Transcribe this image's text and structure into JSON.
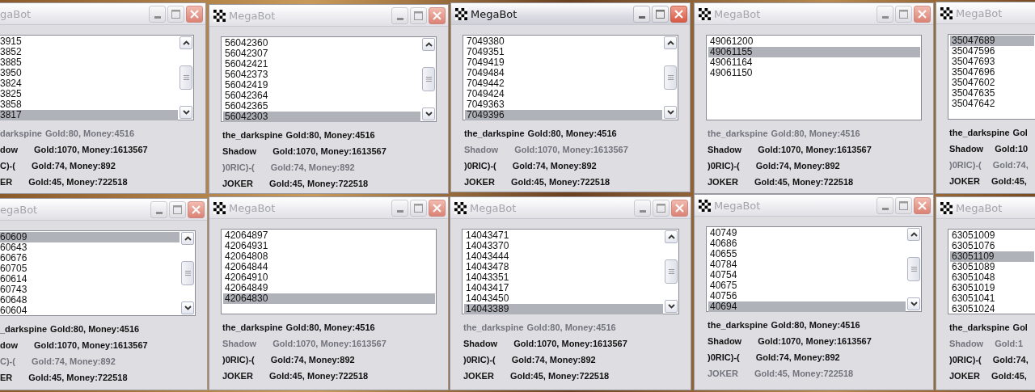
{
  "windows": [
    {
      "kind": "left-cut",
      "title": "gaBot",
      "active": false,
      "scrollbar": true,
      "items": [
        {
          "text": "3915",
          "selected": false
        },
        {
          "text": "3852",
          "selected": false
        },
        {
          "text": "3885",
          "selected": false
        },
        {
          "text": "3950",
          "selected": false
        },
        {
          "text": "3824",
          "selected": false
        },
        {
          "text": "3825",
          "selected": false
        },
        {
          "text": "3858",
          "selected": false
        },
        {
          "text": "3817",
          "selected": true
        }
      ],
      "players": [
        {
          "name": "darkspine",
          "stats": "Gold:80, Money:4516",
          "highlighted": true
        },
        {
          "name": "dow",
          "stats": "Gold:1070, Money:1613567",
          "highlighted": false
        },
        {
          "name": "C)-(",
          "stats": "Gold:74, Money:892",
          "highlighted": false
        },
        {
          "name": "ER",
          "stats": "Gold:45, Money:722518",
          "highlighted": false
        }
      ]
    },
    {
      "kind": "full",
      "title": "MegaBot",
      "active": false,
      "scrollbar": true,
      "items": [
        {
          "text": "56042360",
          "selected": false
        },
        {
          "text": "56042307",
          "selected": false
        },
        {
          "text": "56042421",
          "selected": false
        },
        {
          "text": "56042373",
          "selected": false
        },
        {
          "text": "56042419",
          "selected": false
        },
        {
          "text": "56042364",
          "selected": false
        },
        {
          "text": "56042365",
          "selected": false
        },
        {
          "text": "56042303",
          "selected": true
        }
      ],
      "players": [
        {
          "name": "the_darkspine",
          "stats": "Gold:80, Money:4516",
          "highlighted": false
        },
        {
          "name": "Shadow",
          "stats": "Gold:1070, Money:1613567",
          "highlighted": false
        },
        {
          "name": ")0RIC)-(",
          "stats": "Gold:74, Money:892",
          "highlighted": true
        },
        {
          "name": "JOKER",
          "stats": "Gold:45, Money:722518",
          "highlighted": false
        }
      ]
    },
    {
      "kind": "full",
      "title": "MegaBot",
      "active": true,
      "scrollbar": true,
      "items": [
        {
          "text": "7049380",
          "selected": false
        },
        {
          "text": "7049351",
          "selected": false
        },
        {
          "text": "7049419",
          "selected": false
        },
        {
          "text": "7049484",
          "selected": false
        },
        {
          "text": "7049442",
          "selected": false
        },
        {
          "text": "7049424",
          "selected": false
        },
        {
          "text": "7049363",
          "selected": false
        },
        {
          "text": "7049396",
          "selected": true
        }
      ],
      "players": [
        {
          "name": "the_darkspine",
          "stats": "Gold:80, Money:4516",
          "highlighted": false
        },
        {
          "name": "Shadow",
          "stats": "Gold:1070, Money:1613567",
          "highlighted": true
        },
        {
          "name": ")0RIC)-(",
          "stats": "Gold:74, Money:892",
          "highlighted": false
        },
        {
          "name": "JOKER",
          "stats": "Gold:45, Money:722518",
          "highlighted": false
        }
      ]
    },
    {
      "kind": "full",
      "title": "MegaBot",
      "active": false,
      "scrollbar": false,
      "items": [
        {
          "text": "49061200",
          "selected": false
        },
        {
          "text": "49061155",
          "selected": true
        },
        {
          "text": "49061164",
          "selected": false
        },
        {
          "text": "49061150",
          "selected": false
        }
      ],
      "players": [
        {
          "name": "the_darkspine",
          "stats": "Gold:80, Money:4516",
          "highlighted": true
        },
        {
          "name": "Shadow",
          "stats": "Gold:1070, Money:1613567",
          "highlighted": false
        },
        {
          "name": ")0RIC)-(",
          "stats": "Gold:74, Money:892",
          "highlighted": false
        },
        {
          "name": "JOKER",
          "stats": "Gold:45, Money:722518",
          "highlighted": false
        }
      ]
    },
    {
      "kind": "right-cut",
      "title": "MegaBot",
      "active": false,
      "scrollbar": false,
      "items": [
        {
          "text": "35047689",
          "selected": true
        },
        {
          "text": "35047596",
          "selected": false
        },
        {
          "text": "35047693",
          "selected": false
        },
        {
          "text": "35047696",
          "selected": false
        },
        {
          "text": "35047602",
          "selected": false
        },
        {
          "text": "35047635",
          "selected": false
        },
        {
          "text": "35047642",
          "selected": false
        }
      ],
      "players": [
        {
          "name": "the_darkspine",
          "stats": "Gol",
          "highlighted": false
        },
        {
          "name": "Shadow",
          "stats": "Gold:10",
          "highlighted": false
        },
        {
          "name": ")0RIC)-(",
          "stats": "Gold:74,",
          "highlighted": true
        },
        {
          "name": "JOKER",
          "stats": "Gold:45,",
          "highlighted": false
        }
      ]
    },
    {
      "kind": "left-cut",
      "title": "egaBot",
      "active": false,
      "scrollbar": true,
      "items": [
        {
          "text": "60609",
          "selected": true
        },
        {
          "text": "60643",
          "selected": false
        },
        {
          "text": "60676",
          "selected": false
        },
        {
          "text": "60705",
          "selected": false
        },
        {
          "text": "60614",
          "selected": false
        },
        {
          "text": "60743",
          "selected": false
        },
        {
          "text": "60648",
          "selected": false
        },
        {
          "text": "60604",
          "selected": false
        }
      ],
      "players": [
        {
          "name": "_darkspine",
          "stats": "Gold:80, Money:4516",
          "highlighted": false
        },
        {
          "name": "dow",
          "stats": "Gold:1070, Money:1613567",
          "highlighted": false
        },
        {
          "name": "C)-(",
          "stats": "Gold:74, Money:892",
          "highlighted": true
        },
        {
          "name": "ER",
          "stats": "Gold:45, Money:722518",
          "highlighted": false
        }
      ]
    },
    {
      "kind": "full",
      "title": "MegaBot",
      "active": false,
      "scrollbar": false,
      "items": [
        {
          "text": "42064897",
          "selected": false
        },
        {
          "text": "42064931",
          "selected": false
        },
        {
          "text": "42064808",
          "selected": false
        },
        {
          "text": "42064844",
          "selected": false
        },
        {
          "text": "42064910",
          "selected": false
        },
        {
          "text": "42064849",
          "selected": false
        },
        {
          "text": "42064830",
          "selected": true
        }
      ],
      "players": [
        {
          "name": "the_darkspine",
          "stats": "Gold:80, Money:4516",
          "highlighted": false
        },
        {
          "name": "Shadow",
          "stats": "Gold:1070, Money:1613567",
          "highlighted": true
        },
        {
          "name": ")0RIC)-(",
          "stats": "Gold:74, Money:892",
          "highlighted": false
        },
        {
          "name": "JOKER",
          "stats": "Gold:45, Money:722518",
          "highlighted": false
        }
      ]
    },
    {
      "kind": "full",
      "title": "MegaBot",
      "active": false,
      "scrollbar": true,
      "items": [
        {
          "text": "14043471",
          "selected": false
        },
        {
          "text": "14043370",
          "selected": false
        },
        {
          "text": "14043444",
          "selected": false
        },
        {
          "text": "14043478",
          "selected": false
        },
        {
          "text": "14043351",
          "selected": false
        },
        {
          "text": "14043417",
          "selected": false
        },
        {
          "text": "14043450",
          "selected": false
        },
        {
          "text": "14043389",
          "selected": true
        }
      ],
      "players": [
        {
          "name": "the_darkspine",
          "stats": "Gold:80, Money:4516",
          "highlighted": true
        },
        {
          "name": "Shadow",
          "stats": "Gold:1070, Money:1613567",
          "highlighted": false
        },
        {
          "name": ")0RIC)-(",
          "stats": "Gold:74, Money:892",
          "highlighted": false
        },
        {
          "name": "JOKER",
          "stats": "Gold:45, Money:722518",
          "highlighted": false
        }
      ]
    },
    {
      "kind": "full",
      "title": "MegaBot",
      "active": false,
      "scrollbar": true,
      "items": [
        {
          "text": "40749",
          "selected": false
        },
        {
          "text": "40686",
          "selected": false
        },
        {
          "text": "40655",
          "selected": false
        },
        {
          "text": "40784",
          "selected": false
        },
        {
          "text": "40754",
          "selected": false
        },
        {
          "text": "40675",
          "selected": false
        },
        {
          "text": "40756",
          "selected": false
        },
        {
          "text": "40694",
          "selected": true
        }
      ],
      "players": [
        {
          "name": "the_darkspine",
          "stats": "Gold:80, Money:4516",
          "highlighted": false
        },
        {
          "name": "Shadow",
          "stats": "Gold:1070, Money:1613567",
          "highlighted": false
        },
        {
          "name": ")0RIC)-(",
          "stats": "Gold:74, Money:892",
          "highlighted": false
        },
        {
          "name": "JOKER",
          "stats": "Gold:45, Money:722518",
          "highlighted": true
        }
      ]
    },
    {
      "kind": "right-cut",
      "title": "MegaBot",
      "active": false,
      "scrollbar": false,
      "items": [
        {
          "text": "63051009",
          "selected": false
        },
        {
          "text": "63051076",
          "selected": false
        },
        {
          "text": "63051109",
          "selected": true
        },
        {
          "text": "63051089",
          "selected": false
        },
        {
          "text": "63051048",
          "selected": false
        },
        {
          "text": "63051019",
          "selected": false
        },
        {
          "text": "63051041",
          "selected": false
        },
        {
          "text": "63051024",
          "selected": false
        }
      ],
      "players": [
        {
          "name": "the_darkspine",
          "stats": "Gol",
          "highlighted": false
        },
        {
          "name": "Shadow",
          "stats": "Gold:1",
          "highlighted": true
        },
        {
          "name": ")0RIC)-(",
          "stats": "Gold:74,",
          "highlighted": false
        },
        {
          "name": "JOKER",
          "stats": "Gold:45,",
          "highlighted": false
        }
      ]
    }
  ]
}
